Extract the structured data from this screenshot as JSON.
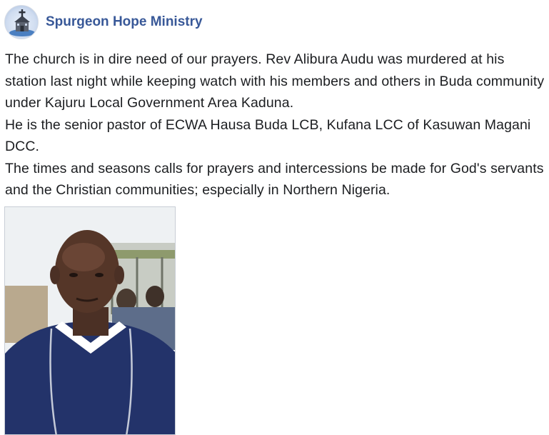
{
  "post": {
    "author": "Spurgeon Hope Ministry",
    "author_avatar_icon": "church-logo-icon",
    "paragraphs": [
      "The church is in dire need of our prayers. Rev Alibura Audu was murdered at his station last night while keeping watch with his members and others in Buda community under Kajuru Local Government Area Kaduna.",
      "He is the senior pastor of ECWA Hausa Buda LCB, Kufana LCC of Kasuwan Magani DCC.",
      "The times and seasons calls for prayers and intercessions be made for God's servants and the Christian communities; especially in Northern Nigeria."
    ],
    "photo_icon": "pastor-portrait-photo"
  },
  "colors": {
    "author_link": "#385898",
    "text": "#1c1e21",
    "background": "#ffffff"
  }
}
